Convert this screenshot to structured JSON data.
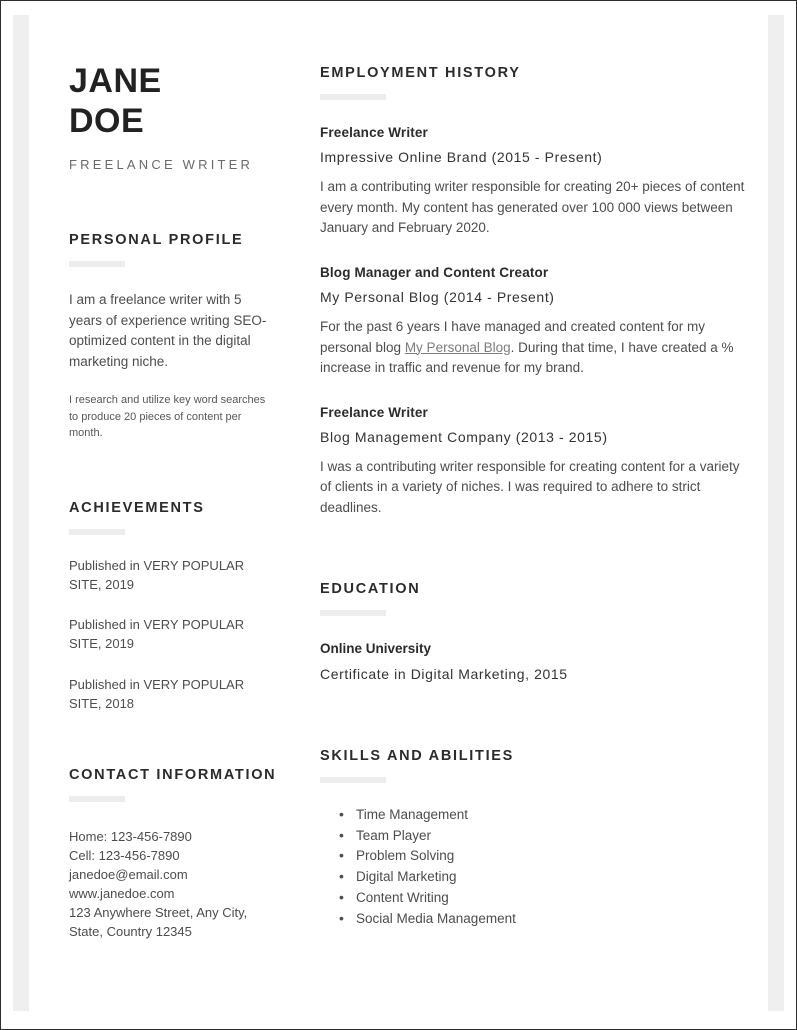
{
  "header": {
    "first_name": "JANE",
    "last_name": "DOE",
    "subtitle": "FREELANCE WRITER"
  },
  "left_column": {
    "profile": {
      "heading": "PERSONAL PROFILE",
      "paragraph_main": "I am a freelance writer with 5 years of experience writing SEO-optimized content in the digital marketing niche.",
      "paragraph_secondary": "I research and utilize key word searches to produce 20 pieces of content per month."
    },
    "achievements": {
      "heading": "ACHIEVEMENTS",
      "items": [
        "Published in VERY POPULAR SITE, 2019",
        "Published in VERY POPULAR SITE, 2019",
        "Published in VERY POPULAR SITE, 2018"
      ]
    },
    "contact": {
      "heading": "CONTACT INFORMATION",
      "home": "Home: 123-456-7890",
      "cell": "Cell: 123-456-7890",
      "email": "janedoe@email.com",
      "website": "www.janedoe.com",
      "address_line1": "123 Anywhere Street, Any City,",
      "address_line2": "State, Country 12345"
    }
  },
  "right_column": {
    "employment": {
      "heading": "EMPLOYMENT HISTORY",
      "jobs": [
        {
          "title": "Freelance Writer",
          "company": "Impressive Online Brand (2015 - Present)",
          "description": "I am a contributing writer responsible for creating 20+ pieces of content every month. My content has generated over 100 000 views between January and February 2020."
        },
        {
          "title": "Blog Manager and Content Creator",
          "company": "My Personal Blog (2014 - Present)",
          "description_before_link": "For the past 6 years I have managed and created content for my personal blog ",
          "link_text": "My Personal Blog",
          "description_after_link": ". During that time, I have created a % increase in traffic and revenue for my brand."
        },
        {
          "title": "Freelance Writer",
          "company": "Blog Management Company (2013 - 2015)",
          "description": "I was a contributing writer responsible for creating content for a variety of clients in a variety of niches. I was required to adhere to strict deadlines."
        }
      ]
    },
    "education": {
      "heading": "EDUCATION",
      "school": "Online University",
      "detail": "Certificate in Digital Marketing, 2015"
    },
    "skills": {
      "heading": "SKILLS AND ABILITIES",
      "items": [
        "Time Management",
        "Team Player",
        "Problem Solving",
        "Digital Marketing",
        "Content Writing",
        "Social Media Management"
      ]
    }
  }
}
